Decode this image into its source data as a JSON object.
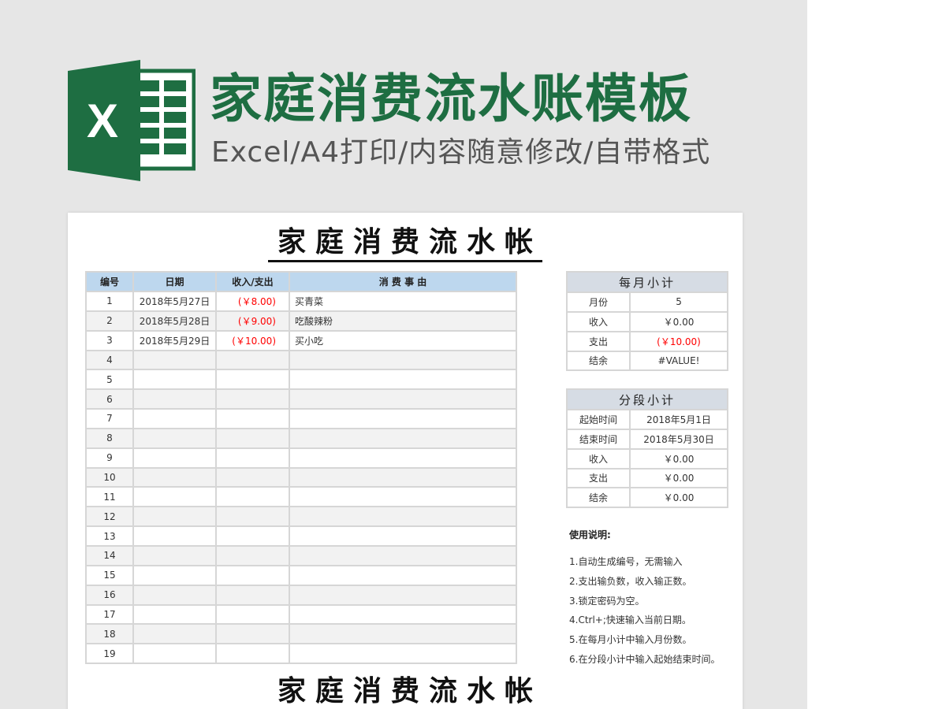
{
  "banner": {
    "title": "家庭消费流水账模板",
    "subtitle": "Excel/A4打印/内容随意修改/自带格式",
    "logo_letter": "X",
    "brand_color": "#1e6e42"
  },
  "sheet": {
    "title": "家庭消费流水帐",
    "columns": [
      "编号",
      "日期",
      "收入/支出",
      "消 费 事 由"
    ],
    "rows": [
      {
        "no": "1",
        "date": "2018年5月27日",
        "amount": "(￥8.00)",
        "reason": "买青菜"
      },
      {
        "no": "2",
        "date": "2018年5月28日",
        "amount": "(￥9.00)",
        "reason": "吃酸辣粉"
      },
      {
        "no": "3",
        "date": "2018年5月29日",
        "amount": "(￥10.00)",
        "reason": "买小吃"
      },
      {
        "no": "4",
        "date": "",
        "amount": "",
        "reason": ""
      },
      {
        "no": "5",
        "date": "",
        "amount": "",
        "reason": ""
      },
      {
        "no": "6",
        "date": "",
        "amount": "",
        "reason": ""
      },
      {
        "no": "7",
        "date": "",
        "amount": "",
        "reason": ""
      },
      {
        "no": "8",
        "date": "",
        "amount": "",
        "reason": ""
      },
      {
        "no": "9",
        "date": "",
        "amount": "",
        "reason": ""
      },
      {
        "no": "10",
        "date": "",
        "amount": "",
        "reason": ""
      },
      {
        "no": "11",
        "date": "",
        "amount": "",
        "reason": ""
      },
      {
        "no": "12",
        "date": "",
        "amount": "",
        "reason": ""
      },
      {
        "no": "13",
        "date": "",
        "amount": "",
        "reason": ""
      },
      {
        "no": "14",
        "date": "",
        "amount": "",
        "reason": ""
      },
      {
        "no": "15",
        "date": "",
        "amount": "",
        "reason": ""
      },
      {
        "no": "16",
        "date": "",
        "amount": "",
        "reason": ""
      },
      {
        "no": "17",
        "date": "",
        "amount": "",
        "reason": ""
      },
      {
        "no": "18",
        "date": "",
        "amount": "",
        "reason": ""
      },
      {
        "no": "19",
        "date": "",
        "amount": "",
        "reason": ""
      }
    ],
    "monthly": {
      "title": "每月小计",
      "rows": [
        {
          "label": "月份",
          "value": "5",
          "neg": false
        },
        {
          "label": "收入",
          "value": "￥0.00",
          "neg": false
        },
        {
          "label": "支出",
          "value": "(￥10.00)",
          "neg": true
        },
        {
          "label": "结余",
          "value": "#VALUE!",
          "neg": false
        }
      ]
    },
    "segment": {
      "title": "分段小计",
      "rows": [
        {
          "label": "起始时间",
          "value": "2018年5月1日",
          "neg": false
        },
        {
          "label": "结束时间",
          "value": "2018年5月30日",
          "neg": false
        },
        {
          "label": "收入",
          "value": "￥0.00",
          "neg": false
        },
        {
          "label": "支出",
          "value": "￥0.00",
          "neg": false
        },
        {
          "label": "结余",
          "value": "￥0.00",
          "neg": false
        }
      ]
    },
    "notes": {
      "title": "使用说明:",
      "items": [
        "1.自动生成编号，无需输入",
        "2.支出输负数，收入输正数。",
        "3.锁定密码为空。",
        "4.Ctrl+;快速输入当前日期。",
        "5.在每月小计中输入月份数。",
        "6.在分段小计中输入起始结束时间。"
      ]
    },
    "neg_color": "#ff0000"
  }
}
